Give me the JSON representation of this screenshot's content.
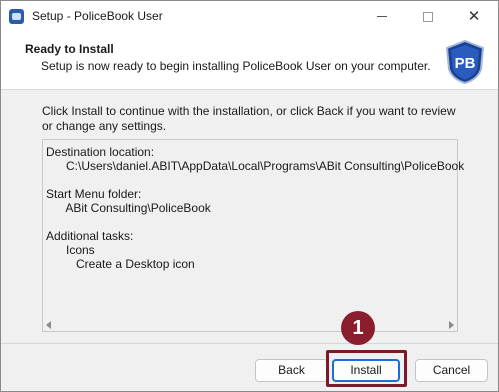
{
  "window": {
    "title": "Setup - PoliceBook User"
  },
  "header": {
    "title": "Ready to Install",
    "subtitle": "Setup is now ready to begin installing PoliceBook User on your computer.",
    "logo_text": "PB"
  },
  "content": {
    "intro": "Click Install to continue with the installation, or click Back if you want to review or change any settings.",
    "summary_lines": [
      "Destination location:",
      "      C:\\Users\\daniel.ABIT\\AppData\\Local\\Programs\\ABit Consulting\\PoliceBook",
      "",
      "Start Menu folder:",
      "      ABit Consulting\\PoliceBook",
      "",
      "Additional tasks:",
      "      Icons",
      "         Create a Desktop icon"
    ]
  },
  "buttons": {
    "back": "Back",
    "install": "Install",
    "cancel": "Cancel"
  },
  "annotation": {
    "step_number": "1",
    "color": "#8b1e2e"
  }
}
